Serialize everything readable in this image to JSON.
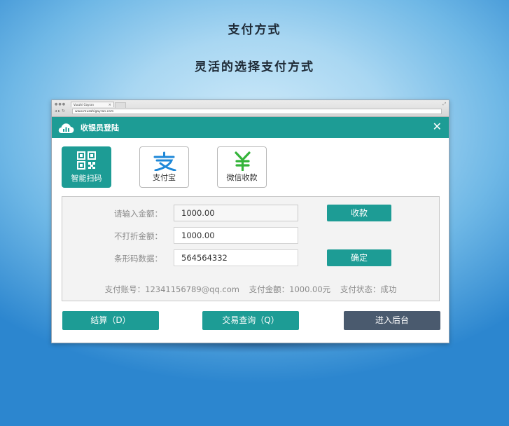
{
  "headline": {
    "title": "支付方式",
    "subtitle": "灵活的选择支付方式"
  },
  "browser": {
    "tab_title": "Vuozhi Gayran",
    "tab_close": "×",
    "url": "www.muzahigayran.com"
  },
  "app": {
    "title": "收银员登陆",
    "close": "✕",
    "brand_color": "#1d9c95"
  },
  "methods": [
    {
      "label": "智能扫码",
      "icon": "qr-code-icon",
      "active": true
    },
    {
      "label": "支付宝",
      "icon": "alipay-icon",
      "active": false
    },
    {
      "label": "微信收款",
      "icon": "yen-icon",
      "active": false
    }
  ],
  "form": {
    "amount_label": "请输入金额：",
    "amount_value": "1000.00",
    "nodiscount_label": "不打折金额：",
    "nodiscount_value": "1000.00",
    "barcode_label": "条形码数据：",
    "barcode_value": "564564332",
    "collect_button": "收款",
    "confirm_button": "确定"
  },
  "status": {
    "account": "支付账号：12341156789@qq.com",
    "amount": "支付金额：1000.00元",
    "state": "支付状态：成功"
  },
  "actions": {
    "settle": "结算（D）",
    "query": "交易查询（Q）",
    "admin": "进入后台",
    "admin_color": "#4a5a6e"
  }
}
